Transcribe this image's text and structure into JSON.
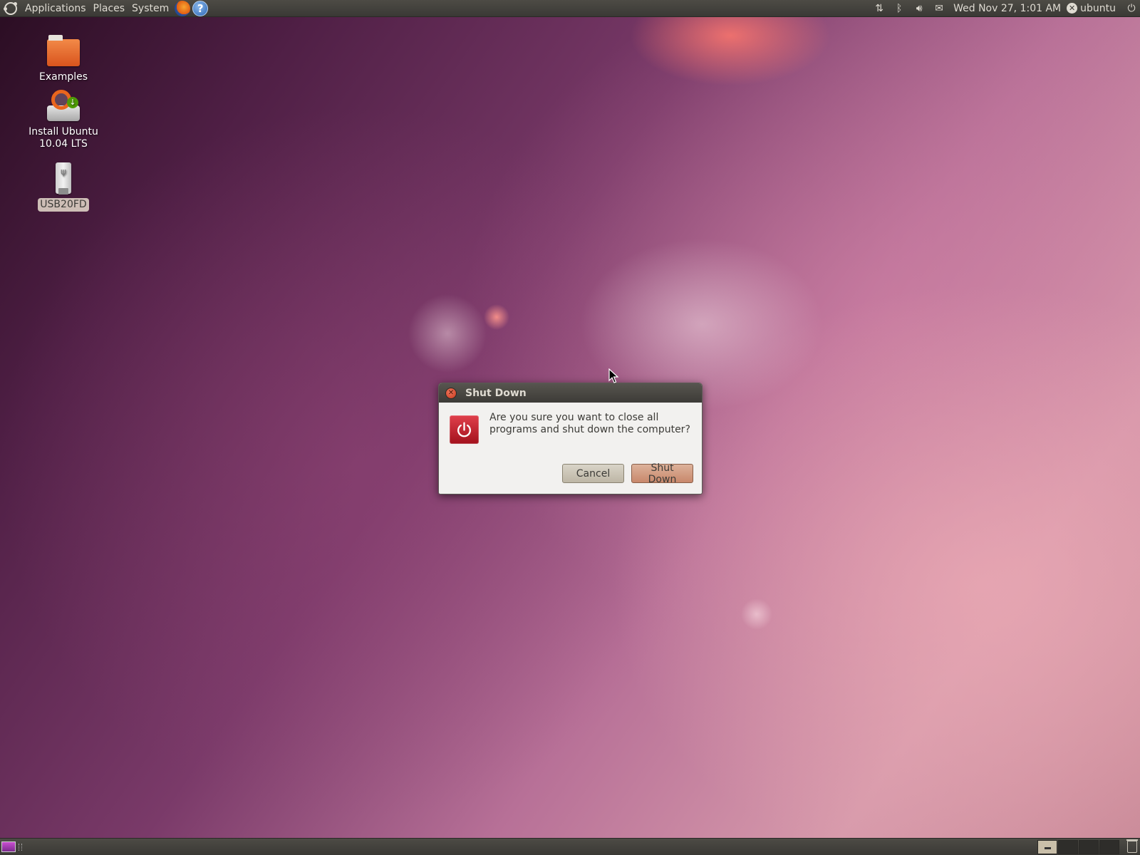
{
  "top_panel": {
    "menus": [
      "Applications",
      "Places",
      "System"
    ],
    "clock": "Wed Nov 27,  1:01 AM",
    "user": "ubuntu",
    "launchers": [
      "firefox-icon",
      "help-icon"
    ],
    "tray_icons": [
      "network-icon",
      "bluetooth-icon",
      "volume-icon",
      "mail-icon"
    ]
  },
  "desktop": {
    "icons": [
      {
        "label": "Examples",
        "icon": "folder-icon",
        "selected": false
      },
      {
        "label": "Install Ubuntu 10.04 LTS",
        "icon": "installer-icon",
        "selected": false
      },
      {
        "label": "USB20FD",
        "icon": "usb-drive-icon",
        "selected": true
      }
    ]
  },
  "dialog": {
    "title": "Shut Down",
    "message": "Are you sure you want to close all programs and shut down the computer?",
    "buttons": {
      "cancel": "Cancel",
      "confirm": "Shut Down"
    }
  },
  "bottom_panel": {
    "workspaces": 4,
    "active_workspace": 1
  },
  "colors": {
    "panel": "#3c3b37",
    "dialog_bg": "#f2f1ef",
    "accent_button": "#c8886b",
    "power_badge": "#c0202c"
  }
}
